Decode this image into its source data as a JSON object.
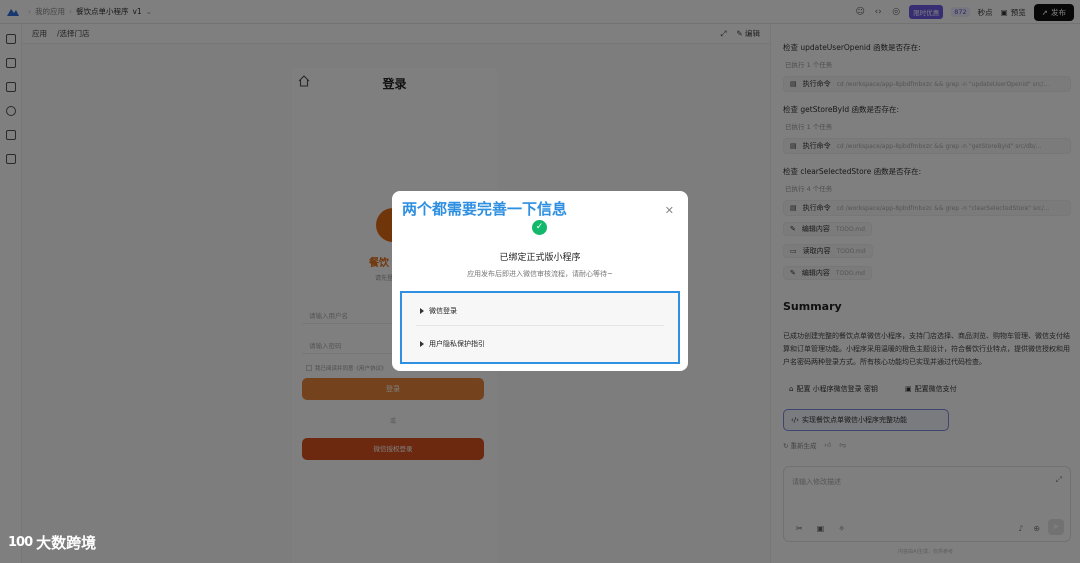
{
  "topbar": {
    "breadcrumb": [
      "我的应用",
      "餐饮点单小程序"
    ],
    "version": "v1",
    "badge": "限时优惠",
    "count": "872",
    "count_suffix": "秒点",
    "preview_label": "预览",
    "publish_label": "发布"
  },
  "preview": {
    "breadcrumb": [
      "应用",
      "/选择门店"
    ],
    "edit_label": "编辑",
    "phone": {
      "title": "登录",
      "brand_name": "餐饮",
      "brand_sub": "请先登",
      "username_placeholder": "请输入用户名",
      "password_placeholder": "请输入密码",
      "agree_text": "我已阅读并同意《用户协议》",
      "login_btn": "登录",
      "or_text": "或",
      "wechat_btn": "微信授权登录"
    }
  },
  "chat": {
    "checks": [
      {
        "question": "检查 updateUserOpenid 函数是否存在:",
        "meta": "已执行 1 个任务",
        "cmd_label": "执行命令",
        "cmd_arg": "cd /workspace/app-8pbdfmbxzc && grep -n \"updateUserOpenid\" src/..."
      },
      {
        "question": "检查 getStoreById 函数是否存在:",
        "meta": "已执行 1 个任务",
        "cmd_label": "执行命令",
        "cmd_arg": "cd /workspace/app-8pbdfmbxzc && grep -n \"getStoreById\" src/db/..."
      },
      {
        "question": "检查 clearSelectedStore 函数是否存在:",
        "meta": "已执行 4 个任务",
        "cmd_label": "执行命令",
        "cmd_arg": "cd /workspace/app-8pbdfmbxzc && grep -n \"clearSelectedStore\" src/..."
      }
    ],
    "chips": [
      {
        "label": "编辑内容",
        "arg": "TODO.md"
      },
      {
        "label": "读取内容",
        "arg": "TODO.md"
      },
      {
        "label": "编辑内容",
        "arg": "TODO.md"
      }
    ],
    "summary_title": "Summary",
    "summary_text": "已成功创建完整的餐饮点单微信小程序，支持门店选择、商品浏览、购物车管理、微信支付结算和订单管理功能。小程序采用温暖的橙色主题设计，符合餐饮行业特点，提供微信授权和用户名密码两种登录方式。所有核心功能均已实现并通过代码检查。",
    "suggestion_1": "配置 小程序微信登录 密钥",
    "suggestion_2": "配置微信支付",
    "suggestion_main": "实现餐饮点单微信小程序完整功能",
    "regen_label": "重新生成",
    "input_placeholder": "请输入修改描述",
    "footer": "内容由AI生成，仅供参考"
  },
  "modal": {
    "annotation": "两个都需要完善一下信息",
    "title": "已绑定正式版小程序",
    "subtitle": "应用发布后即进入微信审核流程，请耐心等待~",
    "items": [
      "微信登录",
      "用户隐私保护指引"
    ]
  },
  "watermark": {
    "logo_text": "100",
    "brand": "大数跨境"
  }
}
